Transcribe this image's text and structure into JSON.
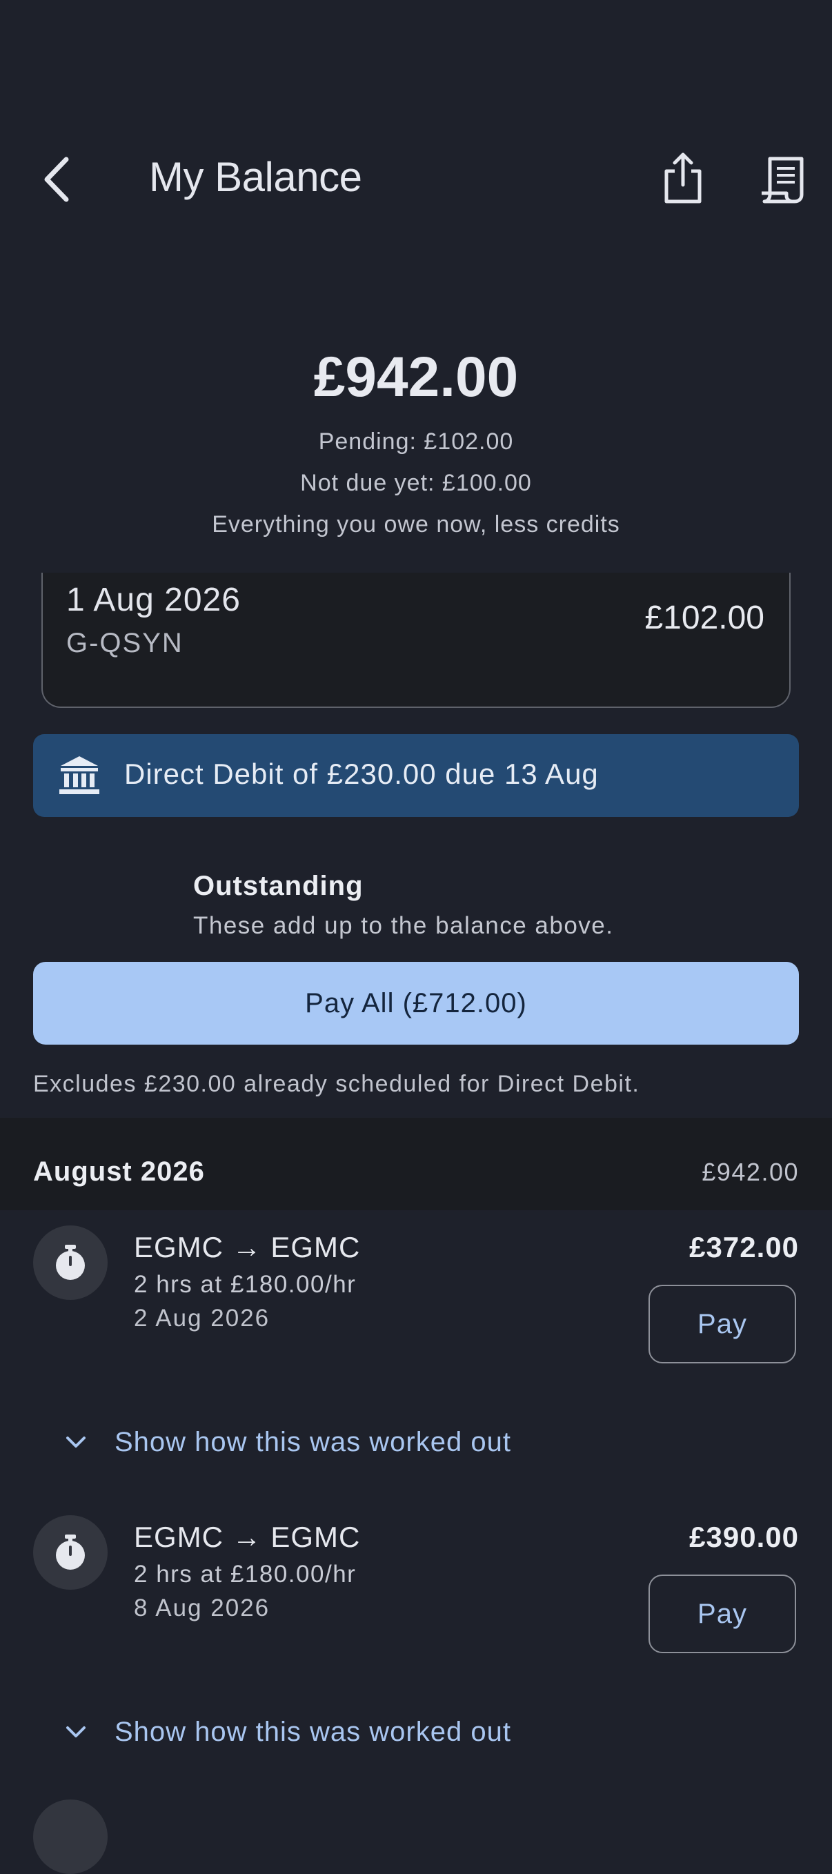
{
  "header": {
    "title": "My Balance",
    "back_icon": "chevron-left-icon",
    "share_icon": "share-icon",
    "receipt_icon": "receipt-icon"
  },
  "summary": {
    "balance": "£942.00",
    "pending": "Pending: £102.00",
    "not_due": "Not due yet: £100.00",
    "note": "Everything you owe now, less credits"
  },
  "pending_card": {
    "date": "1 Aug 2026",
    "registration": "G-QSYN",
    "amount": "£102.00"
  },
  "direct_debit": {
    "icon": "bank-icon",
    "text": "Direct Debit of £230.00 due 13 Aug",
    "color": "#244a73"
  },
  "outstanding": {
    "title": "Outstanding",
    "description": "These add up to the balance above.",
    "pay_all_label": "Pay All (£712.00)",
    "excludes_note": "Excludes £230.00 already scheduled for Direct Debit."
  },
  "month": {
    "label": "August 2026",
    "total": "£942.00"
  },
  "transactions": [
    {
      "icon": "stopwatch-icon",
      "route": "EGMC → EGMC",
      "rate": "2 hrs at £180.00/hr",
      "date": "2 Aug 2026",
      "amount": "£372.00",
      "pay_label": "Pay",
      "show_label": "Show how this was worked out"
    },
    {
      "icon": "stopwatch-icon",
      "route": "EGMC → EGMC",
      "rate": "2 hrs at £180.00/hr",
      "date": "8 Aug 2026",
      "amount": "£390.00",
      "pay_label": "Pay",
      "show_label": "Show how this was worked out"
    }
  ],
  "colors": {
    "background": "#1e212b",
    "accent": "#a8c8f5",
    "link": "#a9c6f0"
  }
}
